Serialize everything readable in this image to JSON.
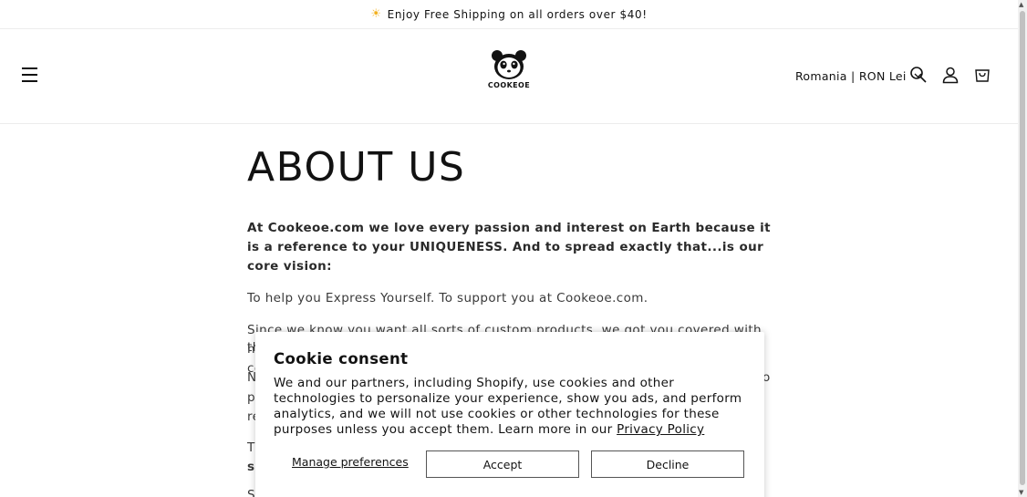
{
  "announcement": {
    "icon": "sun-icon",
    "text": "Enjoy Free Shipping on all orders over $40!"
  },
  "header": {
    "logo_text": "COOKEOE",
    "localization": "Romania | RON Lei"
  },
  "main": {
    "title": "ABOUT US",
    "intro": "At Cookeoe.com we love every passion and interest on Earth because it is a reference to your UNIQUENESS. And to spread exactly that...is our core vision:",
    "p1": "To help you Express Yourself. To support you at Cookeoe.com.",
    "p2": "Since we know you want all sorts of custom products, we got you covered with highly professional suppliers and production houses that we keep in close contact with and vet daily so",
    "p2_tail": "th",
    "p3_head": "N",
    "p3_right": "o",
    "p3_line2": "p",
    "p3_line3": "re",
    "p4_head": "Th",
    "p4_line2": "sp",
    "p5_head": "S"
  },
  "cookie": {
    "title": "Cookie consent",
    "message": "We and our partners, including Shopify, use cookies and other technologies to personalize your experience, show you ads, and perform analytics, and we will not use cookies or other technologies for these purposes unless you accept them. Learn more in our ",
    "privacy_link": "Privacy Policy",
    "manage": "Manage preferences",
    "accept": "Accept",
    "decline": "Decline"
  }
}
